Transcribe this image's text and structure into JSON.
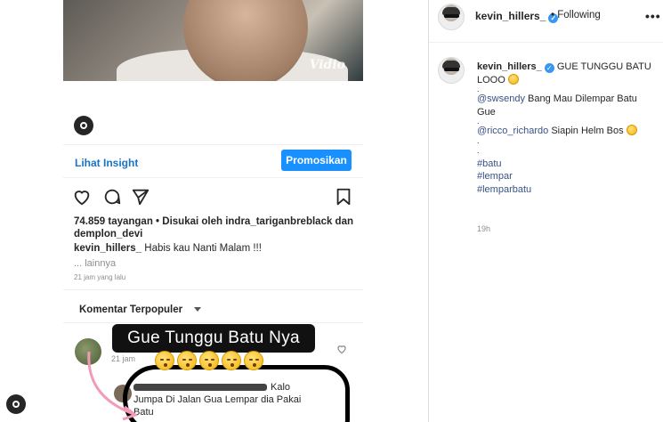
{
  "left": {
    "watermark": "Vidio",
    "insight_link": "Lihat Insight",
    "promote_button": "Promosikan",
    "stats": "74.859 tayangan • Disukai oleh indra_tariganbreblack dan demplon_devi",
    "caption_user": "kevin_hillers_",
    "caption_text": "Habis kau Nanti Malam !!!",
    "more": "... lainnya",
    "timestamp": "21 jam yang lalu",
    "sort_label": "Komentar Terpopuler",
    "comment_time": "21 jam",
    "sticker_text": "Gue Tunggu Batu Nya",
    "reply_text_a": "Kalo",
    "reply_text_b": "Jumpa Di Jalan Gua Lempar dia Pakai",
    "reply_text_c": "Batu",
    "icons": [
      "heart-icon",
      "comment-icon",
      "share-icon",
      "bookmark-icon",
      "chevron-down-icon",
      "profile-icon"
    ]
  },
  "panel": {
    "username": "kevin_hillers_",
    "following": "• Following",
    "more_menu": "•••",
    "caption_user": "kevin_hillers_",
    "caption_line1": "GUE TUNGGU BATU",
    "caption_line2": "LOOO",
    "dot1": ".",
    "mention1": "@swsendy",
    "mention1_text": "Bang Mau Dilempar Batu",
    "mention1_text2": "Gue",
    "dot2": ".",
    "mention2": "@ricco_richardo",
    "mention2_text": "Siapin Helm Bos",
    "dot3": ".",
    "dot4": ".",
    "hashtags": [
      "#batu",
      "#lempar",
      "#lemparbatu"
    ],
    "time": "19h",
    "accent": "#385185",
    "button_color": "#1890ff"
  }
}
